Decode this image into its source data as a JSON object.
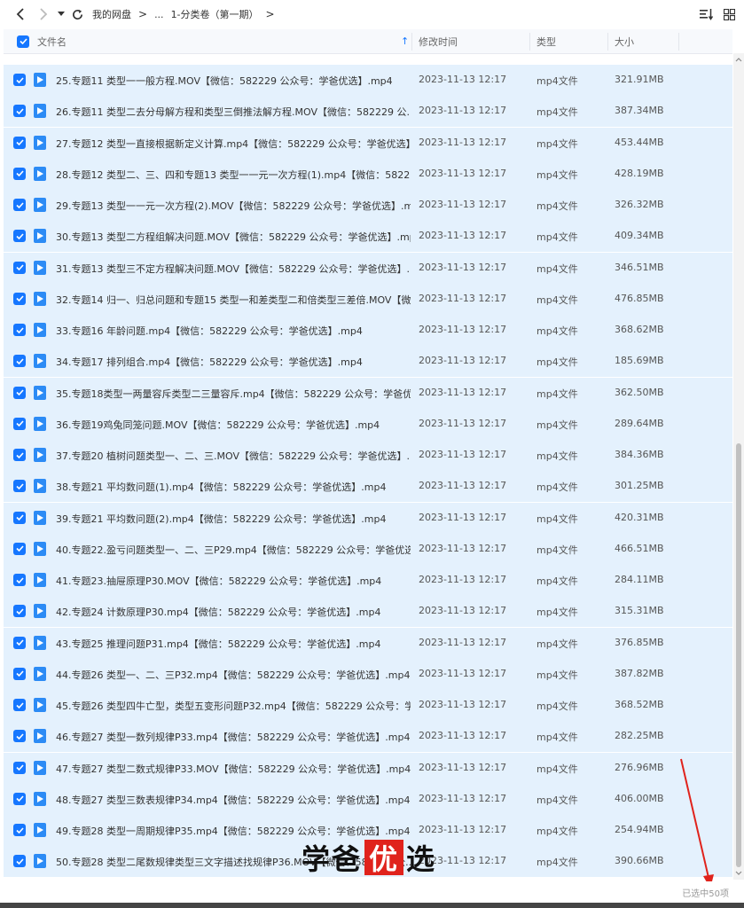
{
  "toolbar": {
    "back_icon": "chevron-left-icon",
    "forward_icon": "chevron-right-icon",
    "breadcrumb": [
      "我的网盘",
      "...",
      "1-分类卷（第一期）"
    ],
    "breadcrumb_sep": ">",
    "sort_icon": "sort-icon",
    "grid_icon": "grid-view-icon"
  },
  "header": {
    "name": "文件名",
    "modified": "修改时间",
    "type": "类型",
    "size": "大小",
    "sort_arrow": "↑"
  },
  "files": [
    {
      "name": "25.专题11 类型一一般方程.MOV【微信：582229 公众号：学爸优选】.mp4",
      "time": "2023-11-13 12:17",
      "type": "mp4文件",
      "size": "321.91MB"
    },
    {
      "name": "26.专题11 类型二去分母解方程和类型三倒推法解方程.MOV【微信：582229 公...",
      "time": "2023-11-13 12:17",
      "type": "mp4文件",
      "size": "387.34MB"
    },
    {
      "name": "27.专题12 类型一直接根据新定义计算.mp4【微信：582229 公众号：学爸优选】...",
      "time": "2023-11-13 12:17",
      "type": "mp4文件",
      "size": "453.44MB"
    },
    {
      "name": "28.专题12 类型二、三、四和专题13 类型一一元一次方程(1).mp4【微信：58222...",
      "time": "2023-11-13 12:17",
      "type": "mp4文件",
      "size": "428.19MB"
    },
    {
      "name": "29.专题13 类型一一元一次方程(2).MOV【微信：582229 公众号：学爸优选】.m...",
      "time": "2023-11-13 12:17",
      "type": "mp4文件",
      "size": "326.32MB"
    },
    {
      "name": "30.专题13 类型二方程组解决问题.MOV【微信：582229 公众号：学爸优选】.mp4",
      "time": "2023-11-13 12:17",
      "type": "mp4文件",
      "size": "409.34MB"
    },
    {
      "name": "31.专题13 类型三不定方程解决问题.MOV【微信：582229 公众号：学爸优选】....",
      "time": "2023-11-13 12:17",
      "type": "mp4文件",
      "size": "346.51MB"
    },
    {
      "name": "32.专题14 归一、归总问题和专题15 类型一和差类型二和倍类型三差倍.MOV【微...",
      "time": "2023-11-13 12:17",
      "type": "mp4文件",
      "size": "476.85MB"
    },
    {
      "name": "33.专题16 年龄问题.mp4【微信：582229 公众号：学爸优选】.mp4",
      "time": "2023-11-13 12:17",
      "type": "mp4文件",
      "size": "368.62MB"
    },
    {
      "name": "34.专题17 排列组合.mp4【微信：582229 公众号：学爸优选】.mp4",
      "time": "2023-11-13 12:17",
      "type": "mp4文件",
      "size": "185.69MB"
    },
    {
      "name": "35.专题18类型一两量容斥类型二三量容斥.mp4【微信：582229 公众号：学爸优...",
      "time": "2023-11-13 12:17",
      "type": "mp4文件",
      "size": "362.50MB"
    },
    {
      "name": "36.专题19鸡兔同笼问题.MOV【微信：582229 公众号：学爸优选】.mp4",
      "time": "2023-11-13 12:17",
      "type": "mp4文件",
      "size": "289.64MB"
    },
    {
      "name": "37.专题20 植树问题类型一、二、三.MOV【微信：582229 公众号：学爸优选】....",
      "time": "2023-11-13 12:17",
      "type": "mp4文件",
      "size": "384.36MB"
    },
    {
      "name": "38.专题21 平均数问题(1).mp4【微信：582229 公众号：学爸优选】.mp4",
      "time": "2023-11-13 12:17",
      "type": "mp4文件",
      "size": "301.25MB"
    },
    {
      "name": "39.专题21 平均数问题(2).mp4【微信：582229 公众号：学爸优选】.mp4",
      "time": "2023-11-13 12:17",
      "type": "mp4文件",
      "size": "420.31MB"
    },
    {
      "name": "40.专题22.盈亏问题类型一、二、三P29.mp4【微信：582229 公众号：学爸优选...",
      "time": "2023-11-13 12:17",
      "type": "mp4文件",
      "size": "466.51MB"
    },
    {
      "name": "41.专题23.抽屉原理P30.MOV【微信：582229 公众号：学爸优选】.mp4",
      "time": "2023-11-13 12:17",
      "type": "mp4文件",
      "size": "284.11MB"
    },
    {
      "name": "42.专题24 计数原理P30.mp4【微信：582229 公众号：学爸优选】.mp4",
      "time": "2023-11-13 12:17",
      "type": "mp4文件",
      "size": "315.31MB"
    },
    {
      "name": "43.专题25 推理问题P31.mp4【微信：582229 公众号：学爸优选】.mp4",
      "time": "2023-11-13 12:17",
      "type": "mp4文件",
      "size": "376.85MB"
    },
    {
      "name": "44.专题26 类型一、二、三P32.mp4【微信：582229 公众号：学爸优选】.mp4",
      "time": "2023-11-13 12:17",
      "type": "mp4文件",
      "size": "387.82MB"
    },
    {
      "name": "45.专题26 类型四牛亡型，类型五变形问题P32.mp4【微信：582229 公众号：学...",
      "time": "2023-11-13 12:17",
      "type": "mp4文件",
      "size": "368.52MB"
    },
    {
      "name": "46.专题27 类型一数列规律P33.mp4【微信：582229 公众号：学爸优选】.mp4",
      "time": "2023-11-13 12:17",
      "type": "mp4文件",
      "size": "282.25MB"
    },
    {
      "name": "47.专题27 类型二数式规律P33.MOV【微信：582229 公众号：学爸优选】.mp4",
      "time": "2023-11-13 12:17",
      "type": "mp4文件",
      "size": "276.96MB"
    },
    {
      "name": "48.专题27 类型三数表规律P34.mp4【微信：582229 公众号：学爸优选】.mp4",
      "time": "2023-11-13 12:17",
      "type": "mp4文件",
      "size": "406.00MB"
    },
    {
      "name": "49.专题28 类型一周期规律P35.mp4【微信：582229 公众号：学爸优选】.mp4",
      "time": "2023-11-13 12:17",
      "type": "mp4文件",
      "size": "254.94MB"
    },
    {
      "name": "50.专题28 类型二尾数规律类型三文字描述找规律P36.MOV【微信：582229 公...",
      "time": "2023-11-13 12:17",
      "type": "mp4文件",
      "size": "390.66MB"
    }
  ],
  "status": {
    "selected_text": "已选中50项"
  },
  "watermark": {
    "text_a": "学爸",
    "text_seal": "优",
    "text_b": "选"
  },
  "colors": {
    "accent": "#1677ff",
    "row_selected": "#e4f1fd",
    "seal": "#e0231c"
  }
}
